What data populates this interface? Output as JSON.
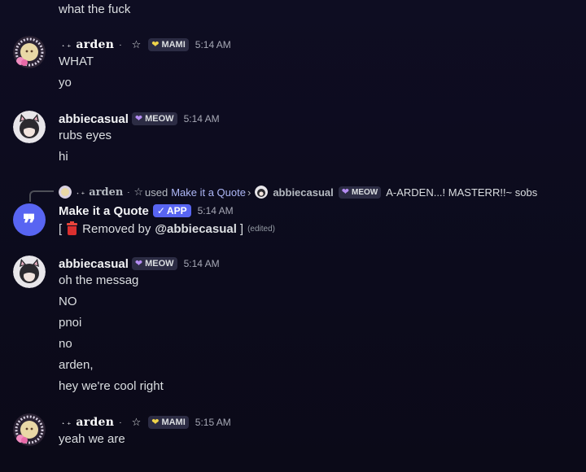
{
  "messages": {
    "first_line": "what the fuck",
    "arden_1": {
      "username": "arden",
      "prefix_glyph": "˖ ₊",
      "dot_glyph": "·",
      "star_glyph": "☆",
      "role_tag": "MAMI",
      "role_heart_color": "#f0d44a",
      "time": "5:14 AM",
      "lines": [
        "WHAT",
        "yo"
      ]
    },
    "abbie_1": {
      "username": "abbiecasual",
      "role_tag": "MEOW",
      "role_heart_color": "#b48cf2",
      "time": "5:14 AM",
      "lines": [
        "rubs eyes",
        "hi"
      ]
    },
    "quote_reply": {
      "author": "arden",
      "prefix_glyph": "˖ ₊",
      "dot_glyph": "·",
      "star_glyph": "☆",
      "used_text": "used",
      "command": "Make it a Quote",
      "target_user": "abbiecasual",
      "target_tag": "MEOW",
      "preview": "A-ARDEN...! MASTERR!!~ sobs"
    },
    "quote_bot": {
      "username": "Make it a Quote",
      "badge": "APP",
      "time": "5:14 AM",
      "open_bracket": "[",
      "removed_text": "Removed by",
      "mention": "@abbiecasual",
      "close_bracket": "]",
      "edited": "(edited)"
    },
    "abbie_2": {
      "username": "abbiecasual",
      "role_tag": "MEOW",
      "time": "5:14 AM",
      "lines": [
        "oh the messag",
        "NO",
        "pnoi",
        "no",
        "arden,",
        "hey we're cool right"
      ]
    },
    "arden_2": {
      "username": "arden",
      "prefix_glyph": "˖ ₊",
      "dot_glyph": "·",
      "star_glyph": "☆",
      "role_tag": "MAMI",
      "time": "5:15 AM",
      "lines": [
        "yeah we are"
      ]
    }
  }
}
